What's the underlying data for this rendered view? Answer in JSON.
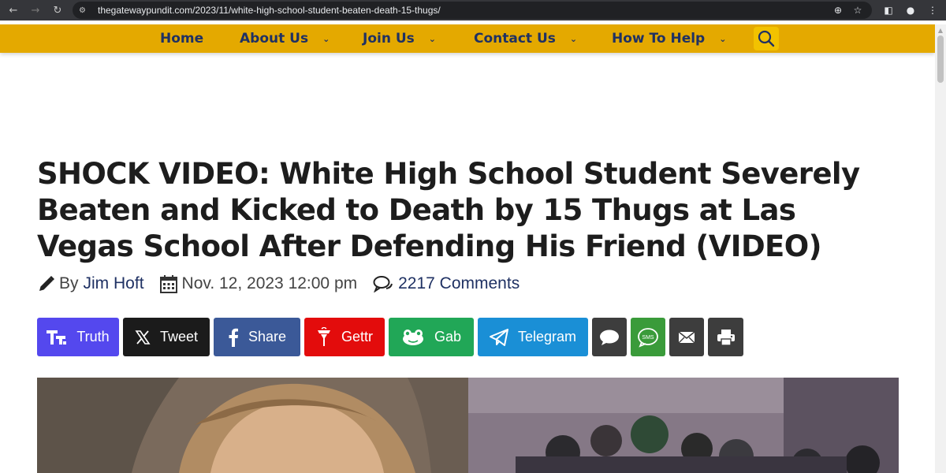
{
  "browser": {
    "url": "thegatewaypundit.com/2023/11/white-high-school-student-beaten-death-15-thugs/"
  },
  "nav": {
    "items": [
      {
        "label": "Home",
        "has_dropdown": false
      },
      {
        "label": "About Us",
        "has_dropdown": true
      },
      {
        "label": "Join Us",
        "has_dropdown": true
      },
      {
        "label": "Contact Us",
        "has_dropdown": true
      },
      {
        "label": "How To Help",
        "has_dropdown": true
      }
    ],
    "search_icon": "search-icon",
    "bar_color": "#e4a900",
    "text_color": "#1f3163"
  },
  "article": {
    "title": "SHOCK VIDEO: White High School Student Severely Beaten and Kicked to Death by 15 Thugs at Las Vegas School After Defending His Friend (VIDEO)",
    "by_label": "By",
    "author": "Jim Hoft",
    "date": "Nov. 12, 2023 12:00 pm",
    "comments": "2217 Comments"
  },
  "share_buttons": [
    {
      "label": "Truth",
      "icon": "truth-social-icon",
      "color": "#5448ee"
    },
    {
      "label": "Tweet",
      "icon": "x-icon",
      "color": "#1b1b1b"
    },
    {
      "label": "Share",
      "icon": "facebook-icon",
      "color": "#3b5998"
    },
    {
      "label": "Gettr",
      "icon": "gettr-icon",
      "color": "#e30c0c"
    },
    {
      "label": "Gab",
      "icon": "gab-icon",
      "color": "#21a757"
    },
    {
      "label": "Telegram",
      "icon": "telegram-icon",
      "color": "#1a8fd6"
    },
    {
      "label": "",
      "icon": "comment-icon",
      "color": "#3d3d3d"
    },
    {
      "label": "",
      "icon": "sms-icon",
      "color": "#3a9b3a"
    },
    {
      "label": "",
      "icon": "email-icon",
      "color": "#3d3d3d"
    },
    {
      "label": "",
      "icon": "print-icon",
      "color": "#3d3d3d"
    }
  ],
  "sms_text": "SMS"
}
